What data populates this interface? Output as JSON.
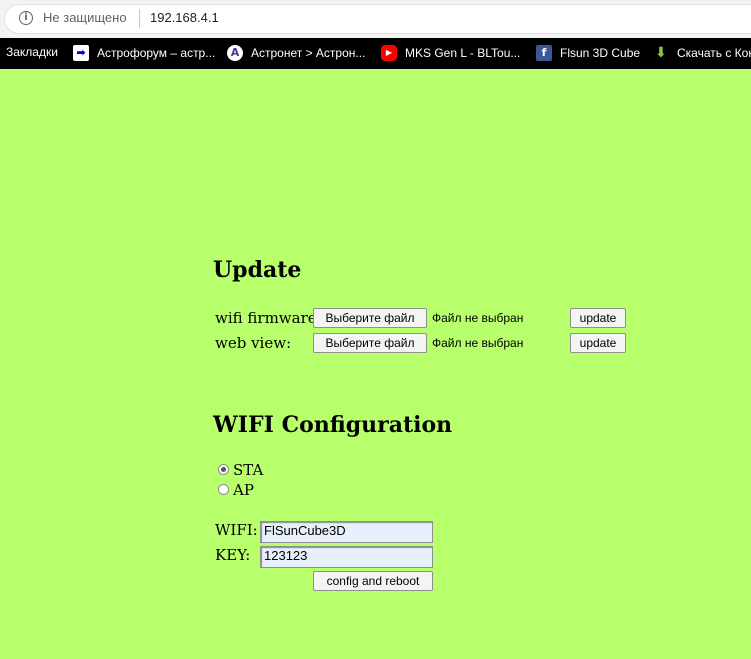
{
  "browser": {
    "insecure_label": "Не защищено",
    "url": "192.168.4.1",
    "bookmarks": [
      {
        "label": "Закладки"
      },
      {
        "label": "Астрофорум – астр..."
      },
      {
        "label": "Астронет > Астрон..."
      },
      {
        "label": "MKS Gen L - BLTou..."
      },
      {
        "label": "Flsun 3D Cube"
      },
      {
        "label": "Скачать с Кон"
      }
    ]
  },
  "update": {
    "heading": "Update",
    "rows": [
      {
        "label": "wifi firmware:",
        "choose": "Выберите файл",
        "status": "Файл не выбран",
        "button": "update"
      },
      {
        "label": "web view:",
        "choose": "Выберите файл",
        "status": "Файл не выбран",
        "button": "update"
      }
    ]
  },
  "wifi": {
    "heading": "WIFI Configuration",
    "modes": [
      {
        "label": "STA",
        "selected": true
      },
      {
        "label": "AP",
        "selected": false
      }
    ],
    "wifi_label": "WIFI:",
    "wifi_value": "FlSunCube3D",
    "key_label": "KEY:",
    "key_value": "123123",
    "submit": "config and reboot"
  },
  "colors": {
    "page_background": "#b8ff6c",
    "bookmark_bar": "#000000"
  }
}
